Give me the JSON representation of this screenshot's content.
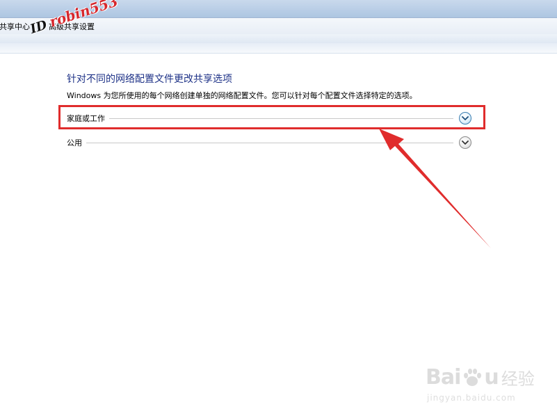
{
  "window": {
    "breadcrumb": [
      {
        "label": "共享中心"
      },
      {
        "label": "高级共享设置"
      }
    ]
  },
  "watermark": {
    "id_prefix": "ID",
    "id_name": "robin553"
  },
  "main": {
    "title": "针对不同的网络配置文件更改共享选项",
    "description": "Windows 为您所使用的每个网络创建单独的网络配置文件。您可以针对每个配置文件选择特定的选项。",
    "sections": [
      {
        "label": "家庭或工作",
        "expanded": false,
        "highlighted": true
      },
      {
        "label": "公用",
        "expanded": false,
        "highlighted": false
      }
    ]
  },
  "annotation": {
    "color": "#e02c2c"
  },
  "baidu_watermark": {
    "brand_left": "Bai",
    "brand_right": "u",
    "brand_cn": "经验",
    "url": "jingyan.baidu.com"
  },
  "colors": {
    "title": "#1e3287",
    "highlight": "#e02c2c"
  }
}
